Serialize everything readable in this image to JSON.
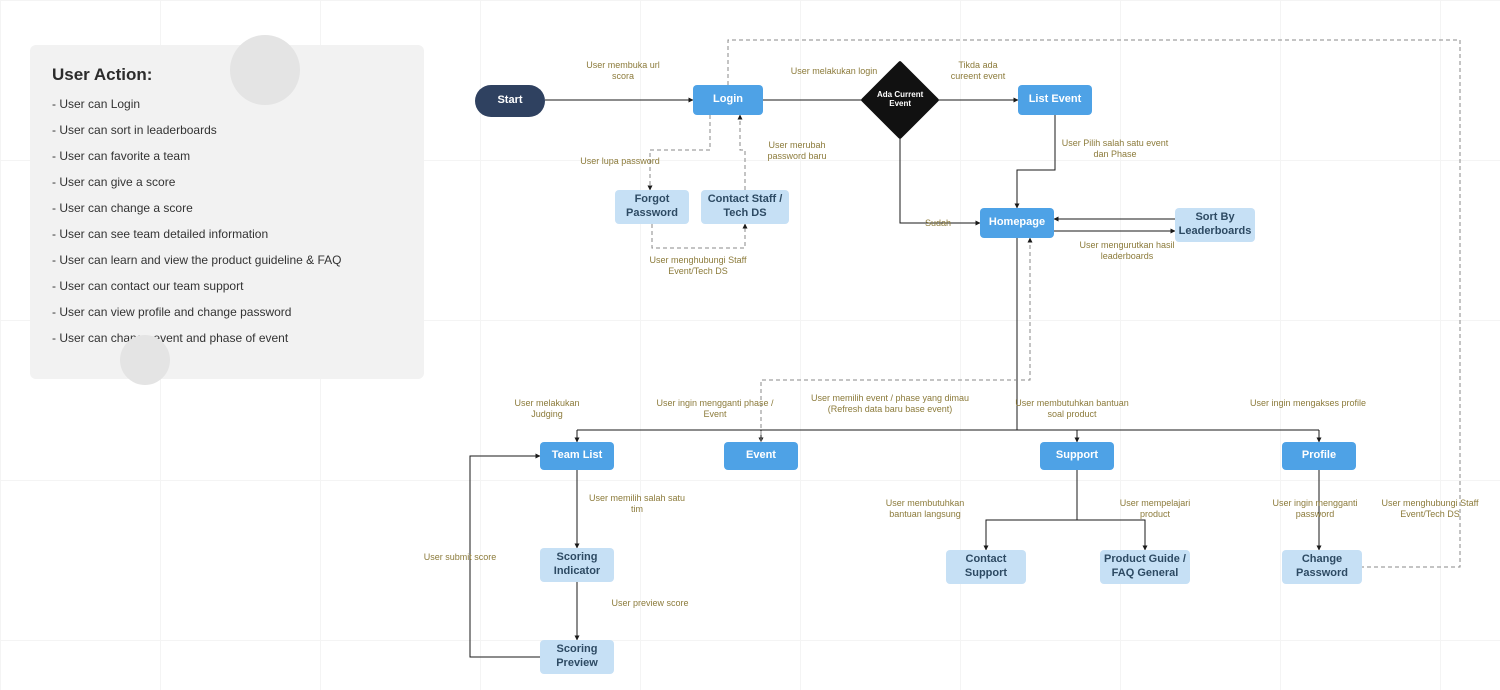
{
  "panel": {
    "title": "User Action:",
    "items": [
      "User can Login",
      "User can sort in leaderboards",
      "User can favorite a team",
      "User can give a score",
      "User can change a score",
      "User can see team detailed information",
      "User can learn and view the product guideline & FAQ",
      "User can contact our team support",
      "User can view profile and change password",
      "User can change event and phase of event"
    ]
  },
  "nodes": {
    "start": "Start",
    "login": "Login",
    "decision": "Ada Current Event",
    "listEvent": "List Event",
    "forgot": "Forgot Password",
    "contactStaff": "Contact Staff / Tech DS",
    "homepage": "Homepage",
    "sortBy": "Sort By Leaderboards",
    "teamList": "Team List",
    "event": "Event",
    "support": "Support",
    "profile": "Profile",
    "scoringInd": "Scoring Indicator",
    "scoringPrev": "Scoring Preview",
    "contactSupport": "Contact Support",
    "productGuide": "Product Guide / FAQ General",
    "changePassword": "Change Password"
  },
  "edges": {
    "startLogin": "User membuka url scora",
    "loginDecision": "User melakukan login",
    "decisionList": "Tikda ada cureent event",
    "listHomepage": "User Pilih salah satu event dan Phase",
    "forgot": "User lupa password",
    "merubah": "User merubah password baru",
    "hubungiStaff": "User menghubungi Staff Event/Tech DS",
    "sudah": "Sudah",
    "sortLabel": "User mengurutkan hasil leaderboards",
    "judging": "User melakukan Judging",
    "gantiPhase": "User ingin mengganti phase / Event",
    "memilihEvent": "User memilih event / phase yang dimau (Refresh data baru base event)",
    "butuhBantuan": "User membutuhkan bantuan soal product",
    "aksesProfile": "User ingin mengakses profile",
    "salahSatuTim": "User memilih salah satu tim",
    "submitScore": "User submit score",
    "previewScore": "User preview score",
    "bantuanLangsung": "User membutuhkan bantuan langsung",
    "mempelajari": "User mempelajari product",
    "gantiPassword": "User ingin mengganti password",
    "hubungiStaff2": "User menghubungi Staff Event/Tech DS"
  }
}
